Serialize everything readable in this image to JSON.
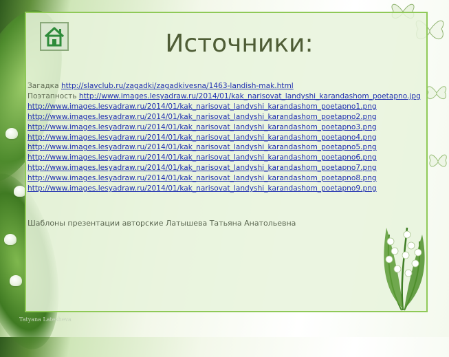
{
  "title": "Источники:",
  "sources": [
    {
      "label": "Загадка",
      "url": "http://slavclub.ru/zagadki/zagadkivesna/1463-landish-mak.html"
    },
    {
      "label": "Поэтапность",
      "url": "http://www.images.lesyadraw.ru/2014/01/kak_narisovat_landyshi_karandashom_poetapno.jpg"
    },
    {
      "label": "",
      "url": "http://www.images.lesyadraw.ru/2014/01/kak_narisovat_landyshi_karandashom_poetapno1.png"
    },
    {
      "label": "",
      "url": "http://www.images.lesyadraw.ru/2014/01/kak_narisovat_landyshi_karandashom_poetapno2.png"
    },
    {
      "label": "",
      "url": "http://www.images.lesyadraw.ru/2014/01/kak_narisovat_landyshi_karandashom_poetapno3.png"
    },
    {
      "label": "",
      "url": "http://www.images.lesyadraw.ru/2014/01/kak_narisovat_landyshi_karandashom_poetapno4.png"
    },
    {
      "label": "",
      "url": "http://www.images.lesyadraw.ru/2014/01/kak_narisovat_landyshi_karandashom_poetapno5.png"
    },
    {
      "label": "",
      "url": "http://www.images.lesyadraw.ru/2014/01/kak_narisovat_landyshi_karandashom_poetapno6.png"
    },
    {
      "label": "",
      "url": "http://www.images.lesyadraw.ru/2014/01/kak_narisovat_landyshi_karandashom_poetapno7.png"
    },
    {
      "label": "",
      "url": "http://www.images.lesyadraw.ru/2014/01/kak_narisovat_landyshi_karandashom_poetapno8.png"
    },
    {
      "label": "",
      "url": "http://www.images.lesyadraw.ru/2014/01/kak_narisovat_landyshi_karandashom_poetapno9.png"
    }
  ],
  "author": "Шаблоны  презентации  авторские  Латышева  Татьяна  Анатольевна",
  "watermark": "Tatyana Latesheva",
  "icons": {
    "home": "home-icon",
    "decor": [
      "butterfly-icon",
      "lily-of-the-valley-icon"
    ]
  },
  "colors": {
    "frame": "#8fc957",
    "title": "#4f5d36",
    "link": "#1f2fb0",
    "home_icon": "#2e8b3a"
  }
}
